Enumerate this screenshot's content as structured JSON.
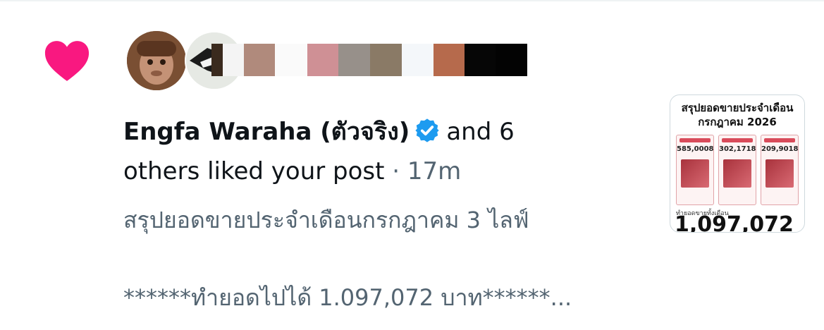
{
  "notification": {
    "type": "like",
    "liker_name": "Engfa Waraha (ตัวจริง)",
    "and_count_text": "and 6",
    "action_text": "others liked your post",
    "separator": "·",
    "time_ago": "17m",
    "post_line1": "สรุปยอดขายประจำเดือนกรกฎาคม 3 ไลฟ์",
    "post_line2": "******ทำยอดไปได้ 1.097,072 บาท******..."
  },
  "thumbnail": {
    "title_line1": "สรุปยอดขายประจำเดือน",
    "title_line2": "กรกฎาคม 2026",
    "col_values": [
      "585,0008",
      "302,1718",
      "209,9018"
    ],
    "total_label": "ทำยอดขายทั้งเดือน",
    "total_value": "1,097,072"
  },
  "colors": {
    "heart": "#f91880",
    "verified": "#1d9bf0",
    "secondary_text": "#536471",
    "primary_text": "#0f1419"
  },
  "swatches": [
    "#3a2a1e",
    "#f4f4f4",
    "#b08a7c",
    "#fafafa",
    "#cf9095",
    "#97908a",
    "#8a7a66",
    "#f4f7fa",
    "#b66a4c",
    "#060606",
    "#030303"
  ],
  "icons": {
    "like": "heart-icon",
    "verified": "verified-badge-icon"
  }
}
